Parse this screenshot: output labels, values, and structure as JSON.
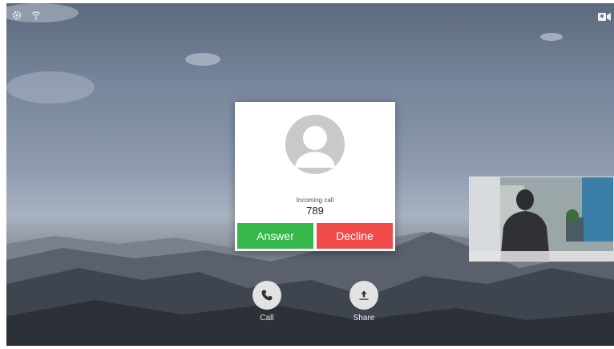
{
  "status_bar": {
    "left_icons": [
      "settings-icon",
      "wireless-icon"
    ],
    "right_icon": "selfview-icon"
  },
  "incoming_call": {
    "status_text": "Incoming call",
    "caller": "789",
    "answer_label": "Answer",
    "decline_label": "Decline",
    "answer_color": "#35b74a",
    "decline_color": "#f04a4a"
  },
  "controls": [
    {
      "label": "Call",
      "icon": "phone-icon"
    },
    {
      "label": "Share",
      "icon": "share-upload-icon"
    }
  ]
}
